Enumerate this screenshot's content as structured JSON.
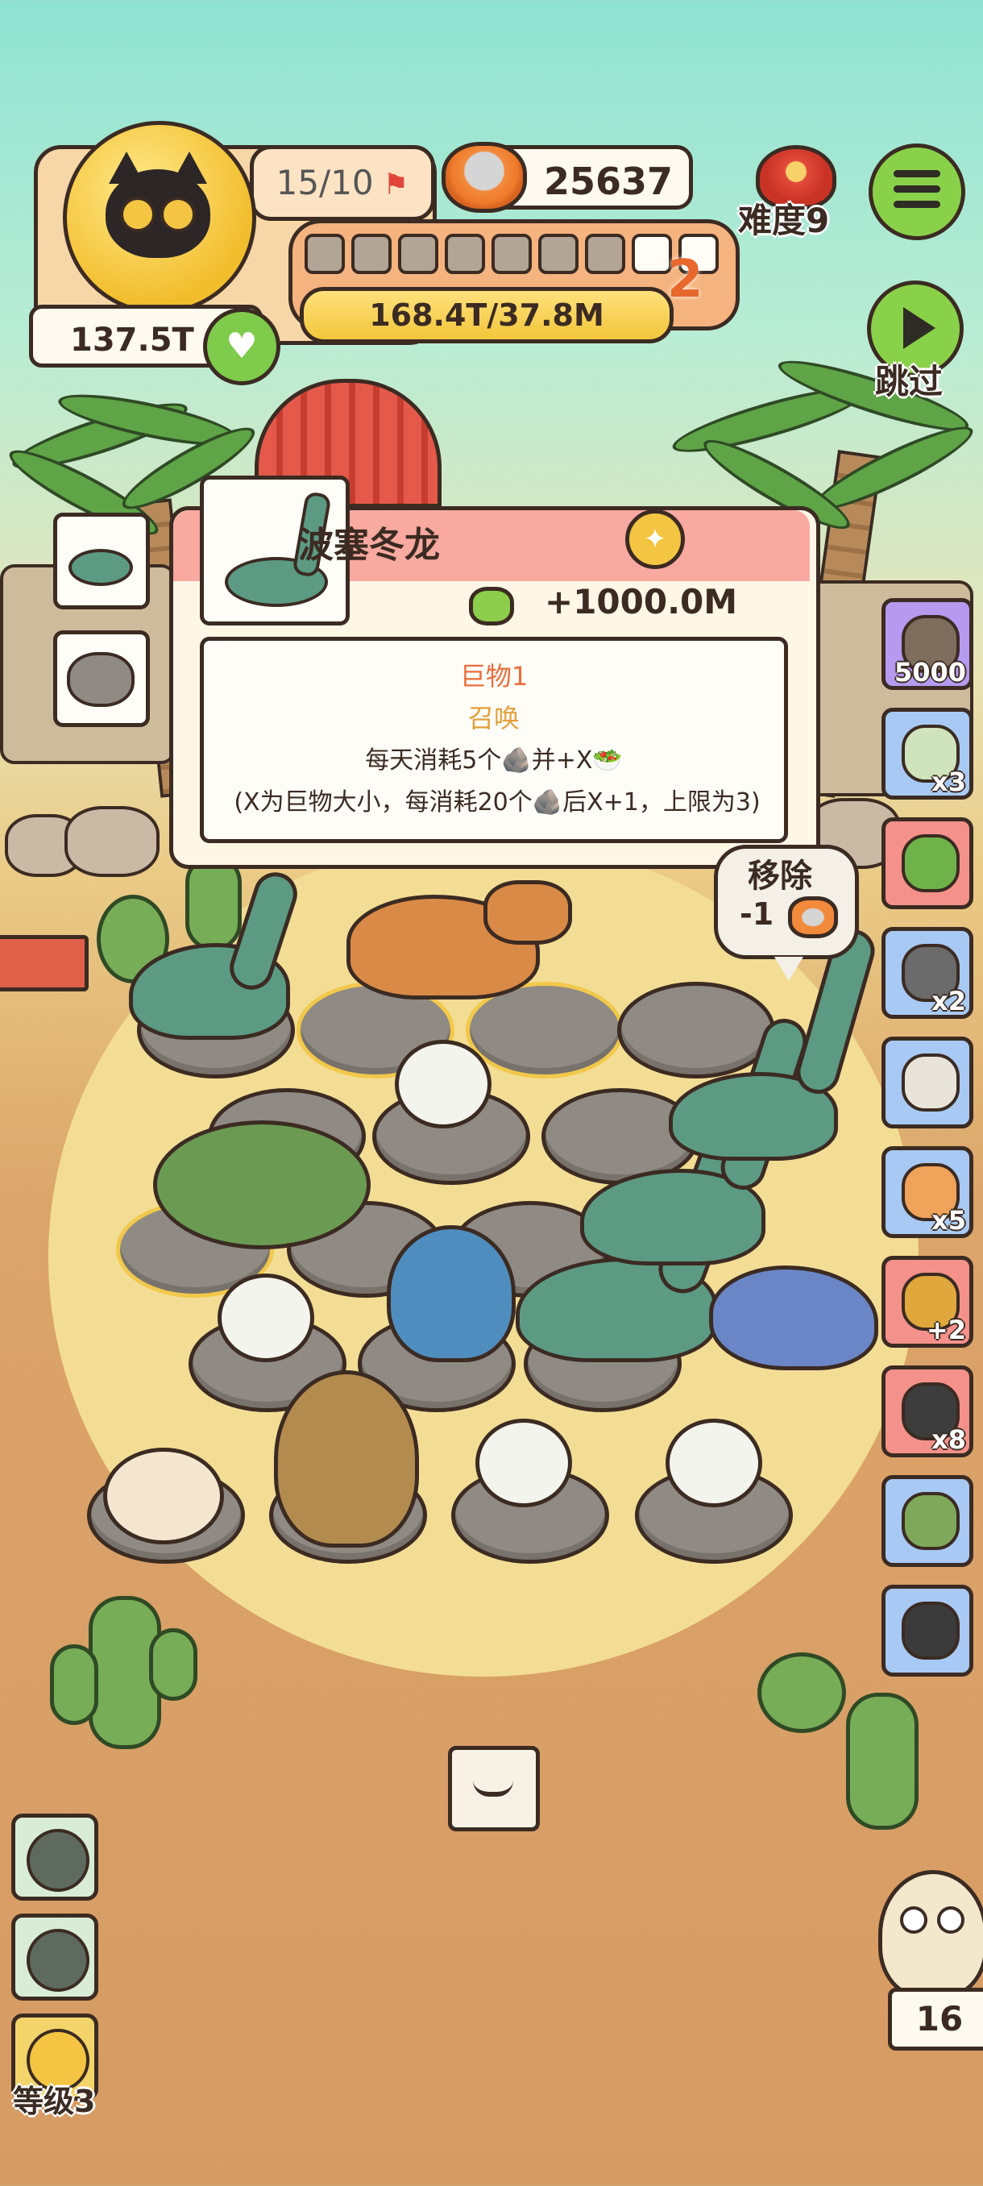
{
  "hud": {
    "wave_progress": "15/10",
    "coins": "25637",
    "score": "137.5T",
    "hp": "168.4T/37.8M",
    "wave_number": "2",
    "pips_total": 9,
    "pips_done": 7,
    "difficulty": "难度9",
    "skip": "跳过"
  },
  "info_card": {
    "title": "波塞冬龙",
    "income": "+1000.0M",
    "rank": "巨物1",
    "type": "召唤",
    "line1": "每天消耗5个🪨并+X🥗",
    "line2": "(X为巨物大小，每消耗20个🪨后X+1，上限为3)"
  },
  "remove_bubble": {
    "label": "移除",
    "cost": "-1"
  },
  "items": [
    {
      "name": "ore-item",
      "count": "5000",
      "color": "purple"
    },
    {
      "name": "seed-packet-item",
      "count": "x3",
      "color": "blue"
    },
    {
      "name": "green-slime-item",
      "count": "",
      "color": "red"
    },
    {
      "name": "tin-can-item",
      "count": "x2",
      "color": "blue"
    },
    {
      "name": "jar-item",
      "count": "",
      "color": "blue"
    },
    {
      "name": "donut-item",
      "count": "x5",
      "color": "blue"
    },
    {
      "name": "ore-plus-item",
      "count": "+2",
      "color": "red"
    },
    {
      "name": "bag-item",
      "count": "x8",
      "color": "red"
    },
    {
      "name": "basket-item",
      "count": "",
      "color": "blue"
    },
    {
      "name": "camera-item",
      "count": "",
      "color": "blue"
    }
  ],
  "bottom": {
    "level": "等级3",
    "owl_count": "16"
  },
  "colors": {
    "accent_green": "#8ad14a",
    "hp_yellow": "#f2c63a",
    "wave_orange": "#e8672d",
    "card_header": "#f8a9a0"
  }
}
